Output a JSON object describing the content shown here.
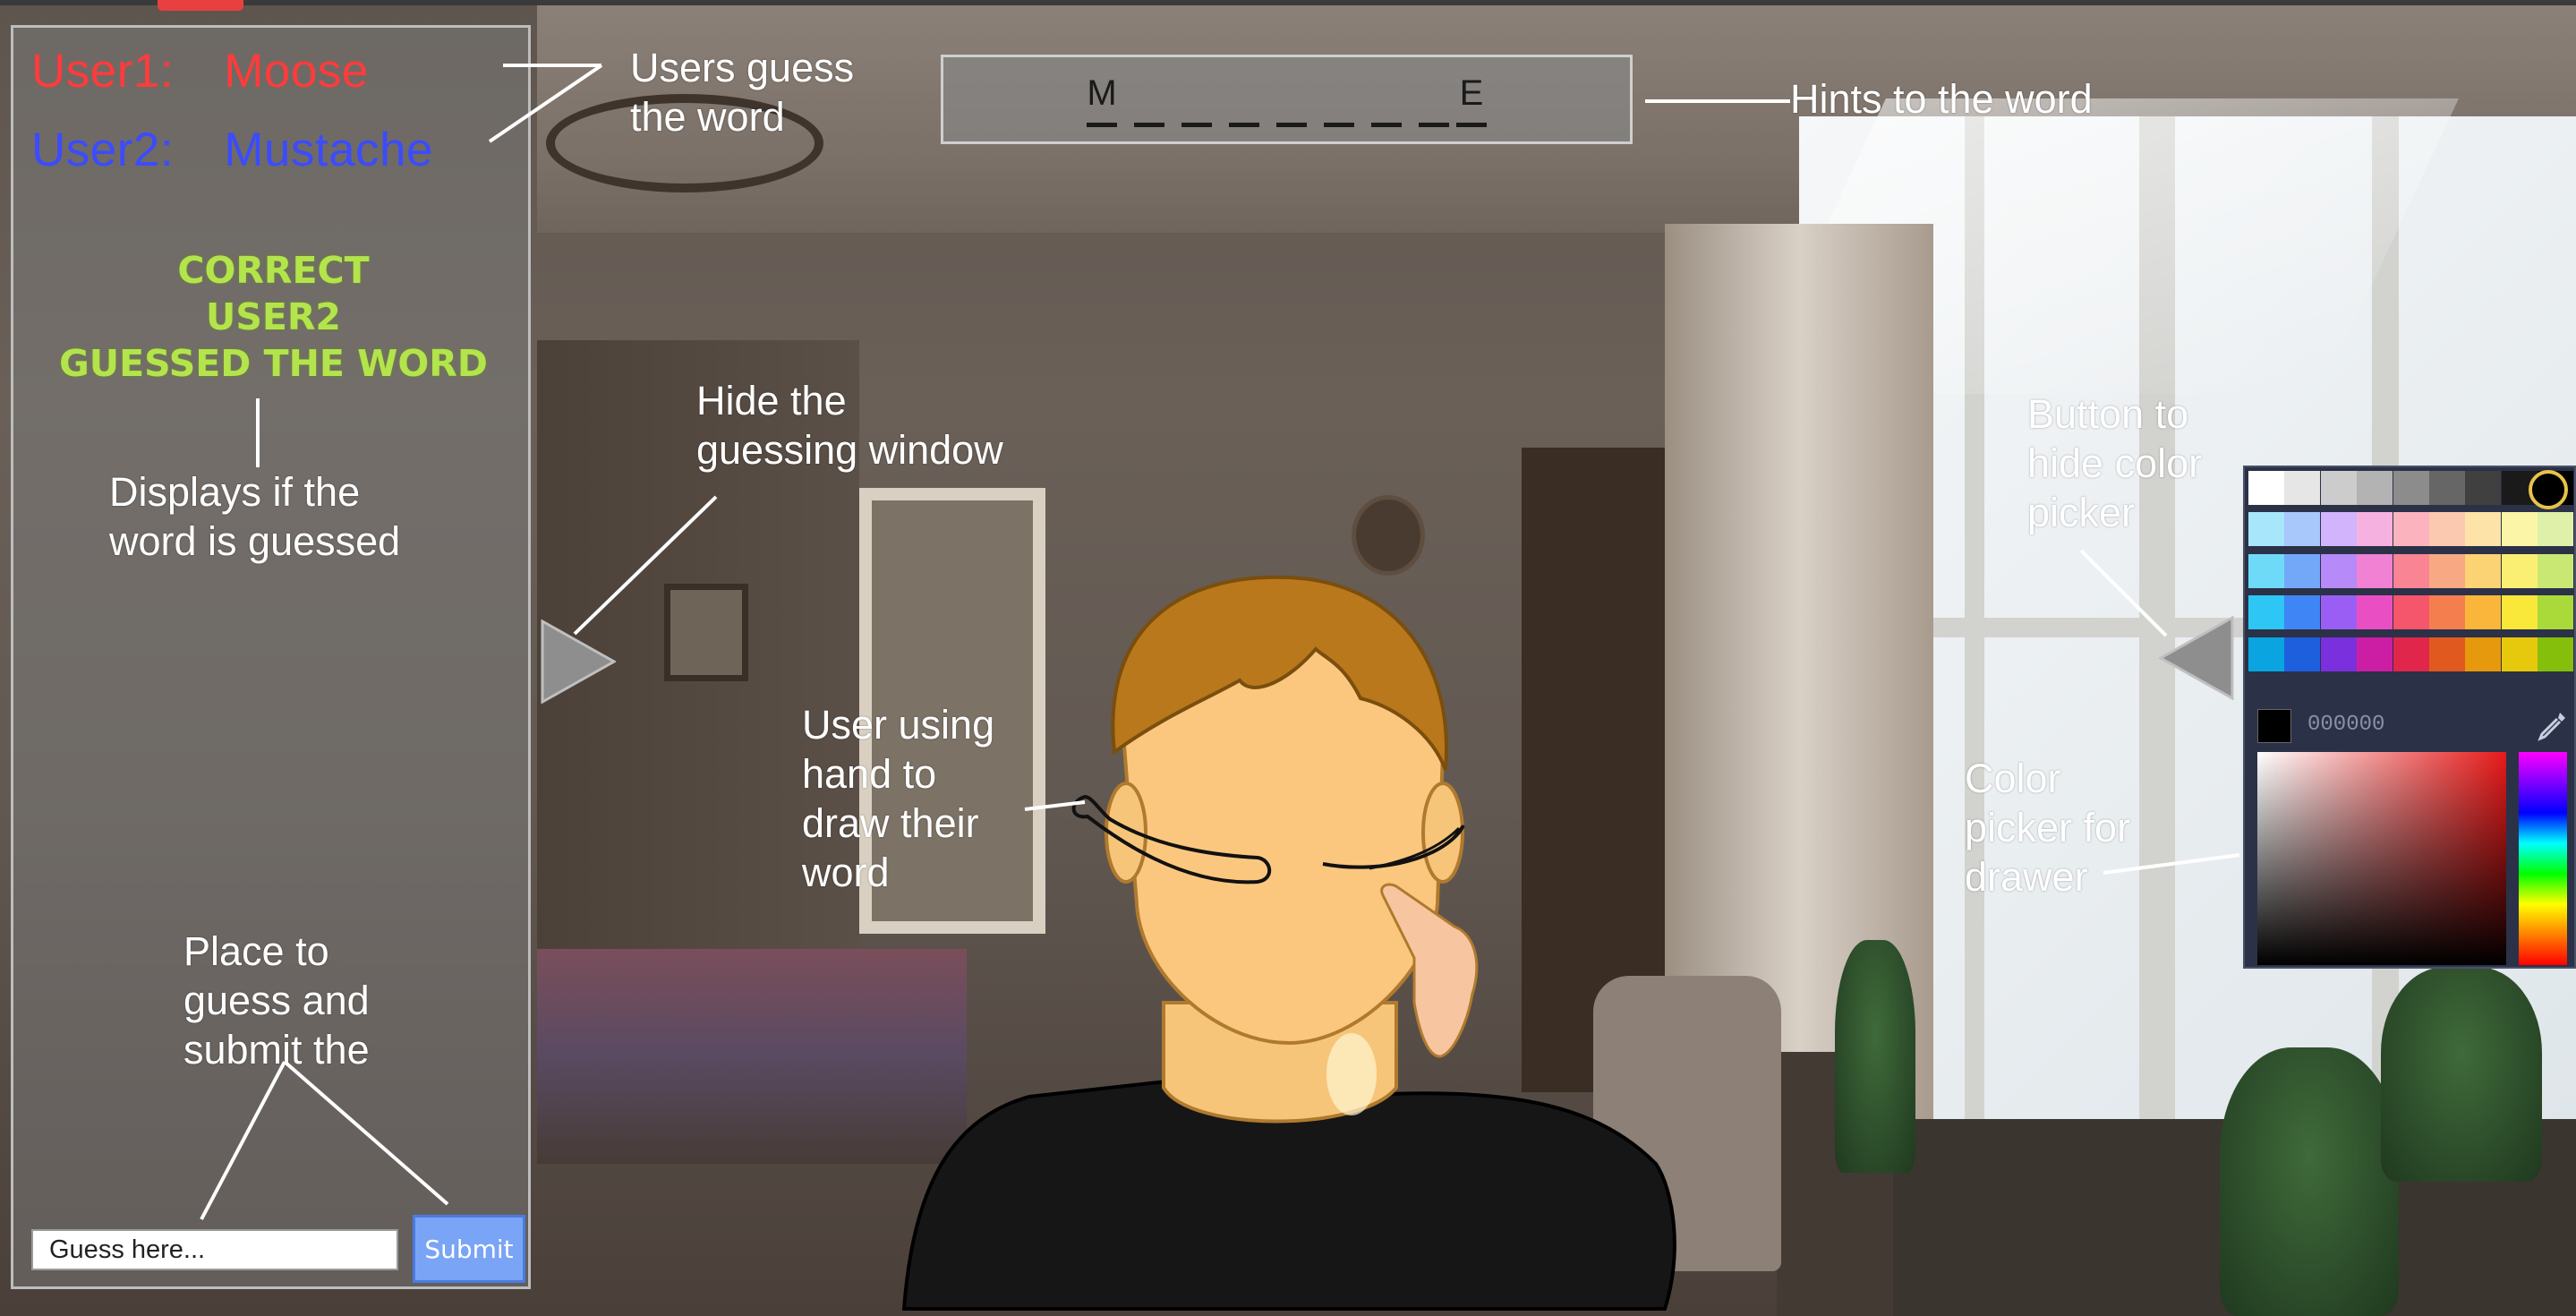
{
  "users": [
    {
      "label": "User1:",
      "name": "Moose",
      "color": "#ff3b3b"
    },
    {
      "label": "User2:",
      "name": "Mustache",
      "color": "#3b4bff"
    }
  ],
  "status": {
    "line1": "CORRECT",
    "line2": "USER2",
    "line3": "GUESSED THE WORD",
    "color": "#b4e44c"
  },
  "guess": {
    "placeholder": "Guess here...",
    "submit_label": "Submit"
  },
  "hints": {
    "slots": [
      "M",
      "",
      "",
      "",
      "",
      "",
      "",
      "",
      "E"
    ]
  },
  "color_picker": {
    "hex_value": "000000",
    "selected_color": "#000000",
    "swatch_rows": [
      [
        "#ffffff",
        "#e6e6e6",
        "#cccccc",
        "#b3b3b3",
        "#8c8c8c",
        "#666666",
        "#404040",
        "#1a1a1a",
        "#000000"
      ],
      [
        "#a7e6fb",
        "#a8c8fb",
        "#d1b4fb",
        "#f5b2e1",
        "#fbb3bd",
        "#fbc8b0",
        "#fde3a8",
        "#fbf5a8",
        "#dff0a8"
      ],
      [
        "#6fdaf8",
        "#73a8f8",
        "#b68af8",
        "#f081d3",
        "#f88494",
        "#f8a883",
        "#fbd274",
        "#fbef73",
        "#c9e873"
      ],
      [
        "#2ec6f5",
        "#3f85f5",
        "#9a5ef5",
        "#e94fc3",
        "#f5566b",
        "#f57e4f",
        "#f9b63b",
        "#f9e73a",
        "#a9da3a"
      ],
      [
        "#0aa5e0",
        "#1e5fdd",
        "#7a30dd",
        "#cc1ea5",
        "#e0264a",
        "#e05a20",
        "#e6990c",
        "#e6c90c",
        "#86be0c"
      ]
    ]
  },
  "annotations": {
    "users_guess": "Users guess\nthe word",
    "hints": "Hints to the word",
    "status": "Displays if the\nword is guessed",
    "hide_guess": "Hide the\nguessing window",
    "drawing": "User using\nhand to\ndraw their\nword",
    "hide_picker": "Button to\nhide color\npicker",
    "picker": "Color\npicker for\ndrawer",
    "guess_submit": "Place to\nguess and\nsubmit the"
  }
}
